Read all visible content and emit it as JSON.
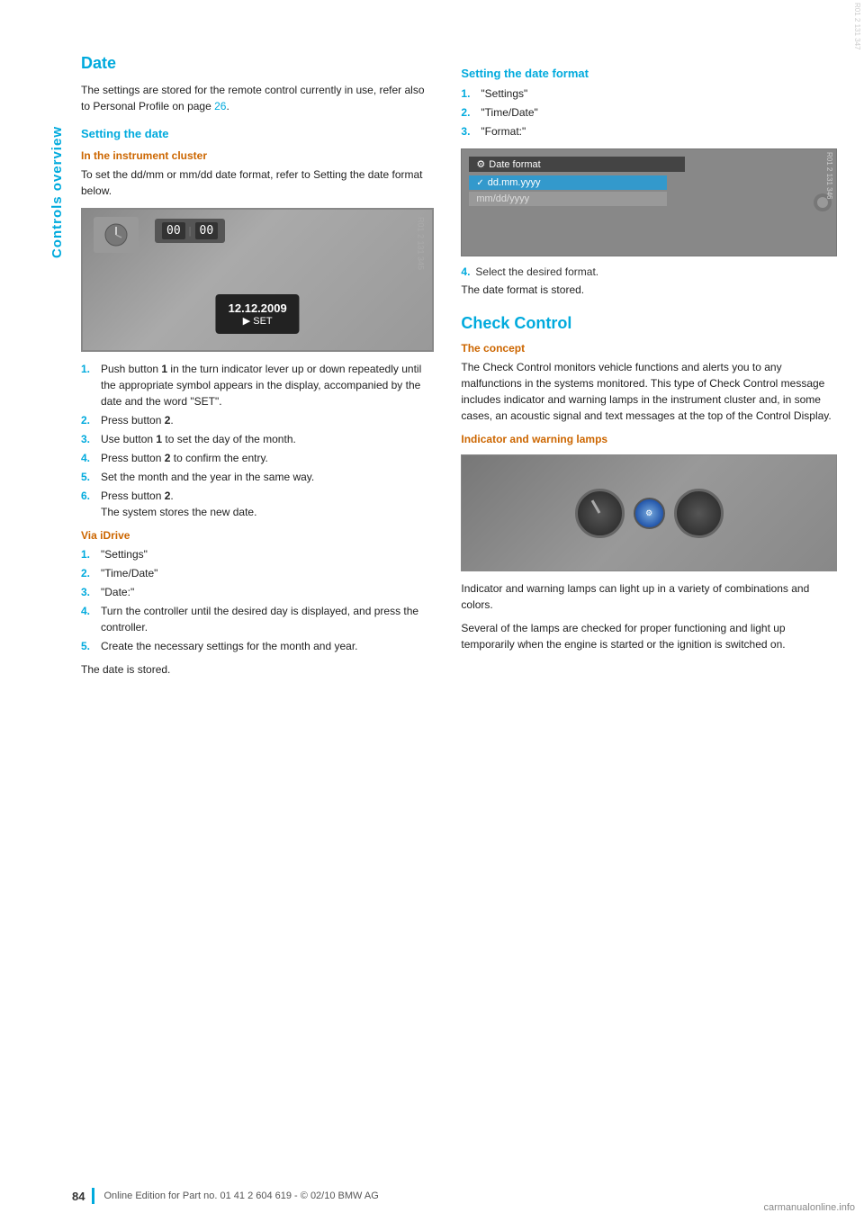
{
  "sidebar": {
    "label": "Controls overview"
  },
  "left_col": {
    "section_title": "Date",
    "intro_text": "The settings are stored for the remote control currently in use, refer also to Personal Profile on page 26.",
    "setting_date": {
      "title": "Setting the date",
      "in_cluster": {
        "title": "In the instrument cluster",
        "text": "To set the dd/mm or mm/dd date format, refer to Setting the date format below."
      },
      "cluster_date": "12.12.2009",
      "cluster_set": "▶ SET",
      "steps_cluster": [
        {
          "num": "1.",
          "text": "Push button 1 in the turn indicator lever up or down repeatedly until the appropriate symbol appears in the display, accompanied by the date and the word \"SET\"."
        },
        {
          "num": "2.",
          "text": "Press button 2."
        },
        {
          "num": "3.",
          "text": "Use button 1 to set the day of the month."
        },
        {
          "num": "4.",
          "text": "Press button 2 to confirm the entry."
        },
        {
          "num": "5.",
          "text": "Set the month and the year in the same way."
        },
        {
          "num": "6.",
          "text": "Press button 2.\nThe system stores the new date."
        }
      ],
      "via_idrive": {
        "title": "Via iDrive",
        "steps": [
          {
            "num": "1.",
            "text": "\"Settings\""
          },
          {
            "num": "2.",
            "text": "\"Time/Date\""
          },
          {
            "num": "3.",
            "text": "\"Date:\""
          },
          {
            "num": "4.",
            "text": "Turn the controller until the desired day is displayed, and press the controller."
          },
          {
            "num": "5.",
            "text": "Create the necessary settings for the month and year."
          }
        ],
        "footer_text": "The date is stored."
      }
    }
  },
  "right_col": {
    "setting_date_format": {
      "title": "Setting the date format",
      "steps": [
        {
          "num": "1.",
          "text": "\"Settings\""
        },
        {
          "num": "2.",
          "text": "\"Time/Date\""
        },
        {
          "num": "3.",
          "text": "\"Format:\""
        }
      ],
      "date_format_header": "Date format",
      "date_format_selected": "✓ dd.mm.yyyy",
      "date_format_unselected": "mm/dd/yyyy",
      "step4": "4.",
      "step4_text": "Select the desired format.",
      "footer_text": "The date format is stored."
    },
    "check_control": {
      "title": "Check Control",
      "concept": {
        "title": "The concept",
        "text": "The Check Control monitors vehicle functions and alerts you to any malfunctions in the systems monitored. This type of Check Control message includes indicator and warning lamps in the instrument cluster and, in some cases, an acoustic signal and text messages at the top of the Control Display."
      },
      "indicator_lamps": {
        "title": "Indicator and warning lamps",
        "text1": "Indicator and warning lamps can light up in a variety of combinations and colors.",
        "text2": "Several of the lamps are checked for proper functioning and light up temporarily when the engine is started or the ignition is switched on."
      }
    }
  },
  "footer": {
    "page_number": "84",
    "footer_text": "Online Edition for Part no. 01 41 2 604 619 - © 02/10 BMW AG"
  },
  "bottom_logo": "carmanualonline.info"
}
